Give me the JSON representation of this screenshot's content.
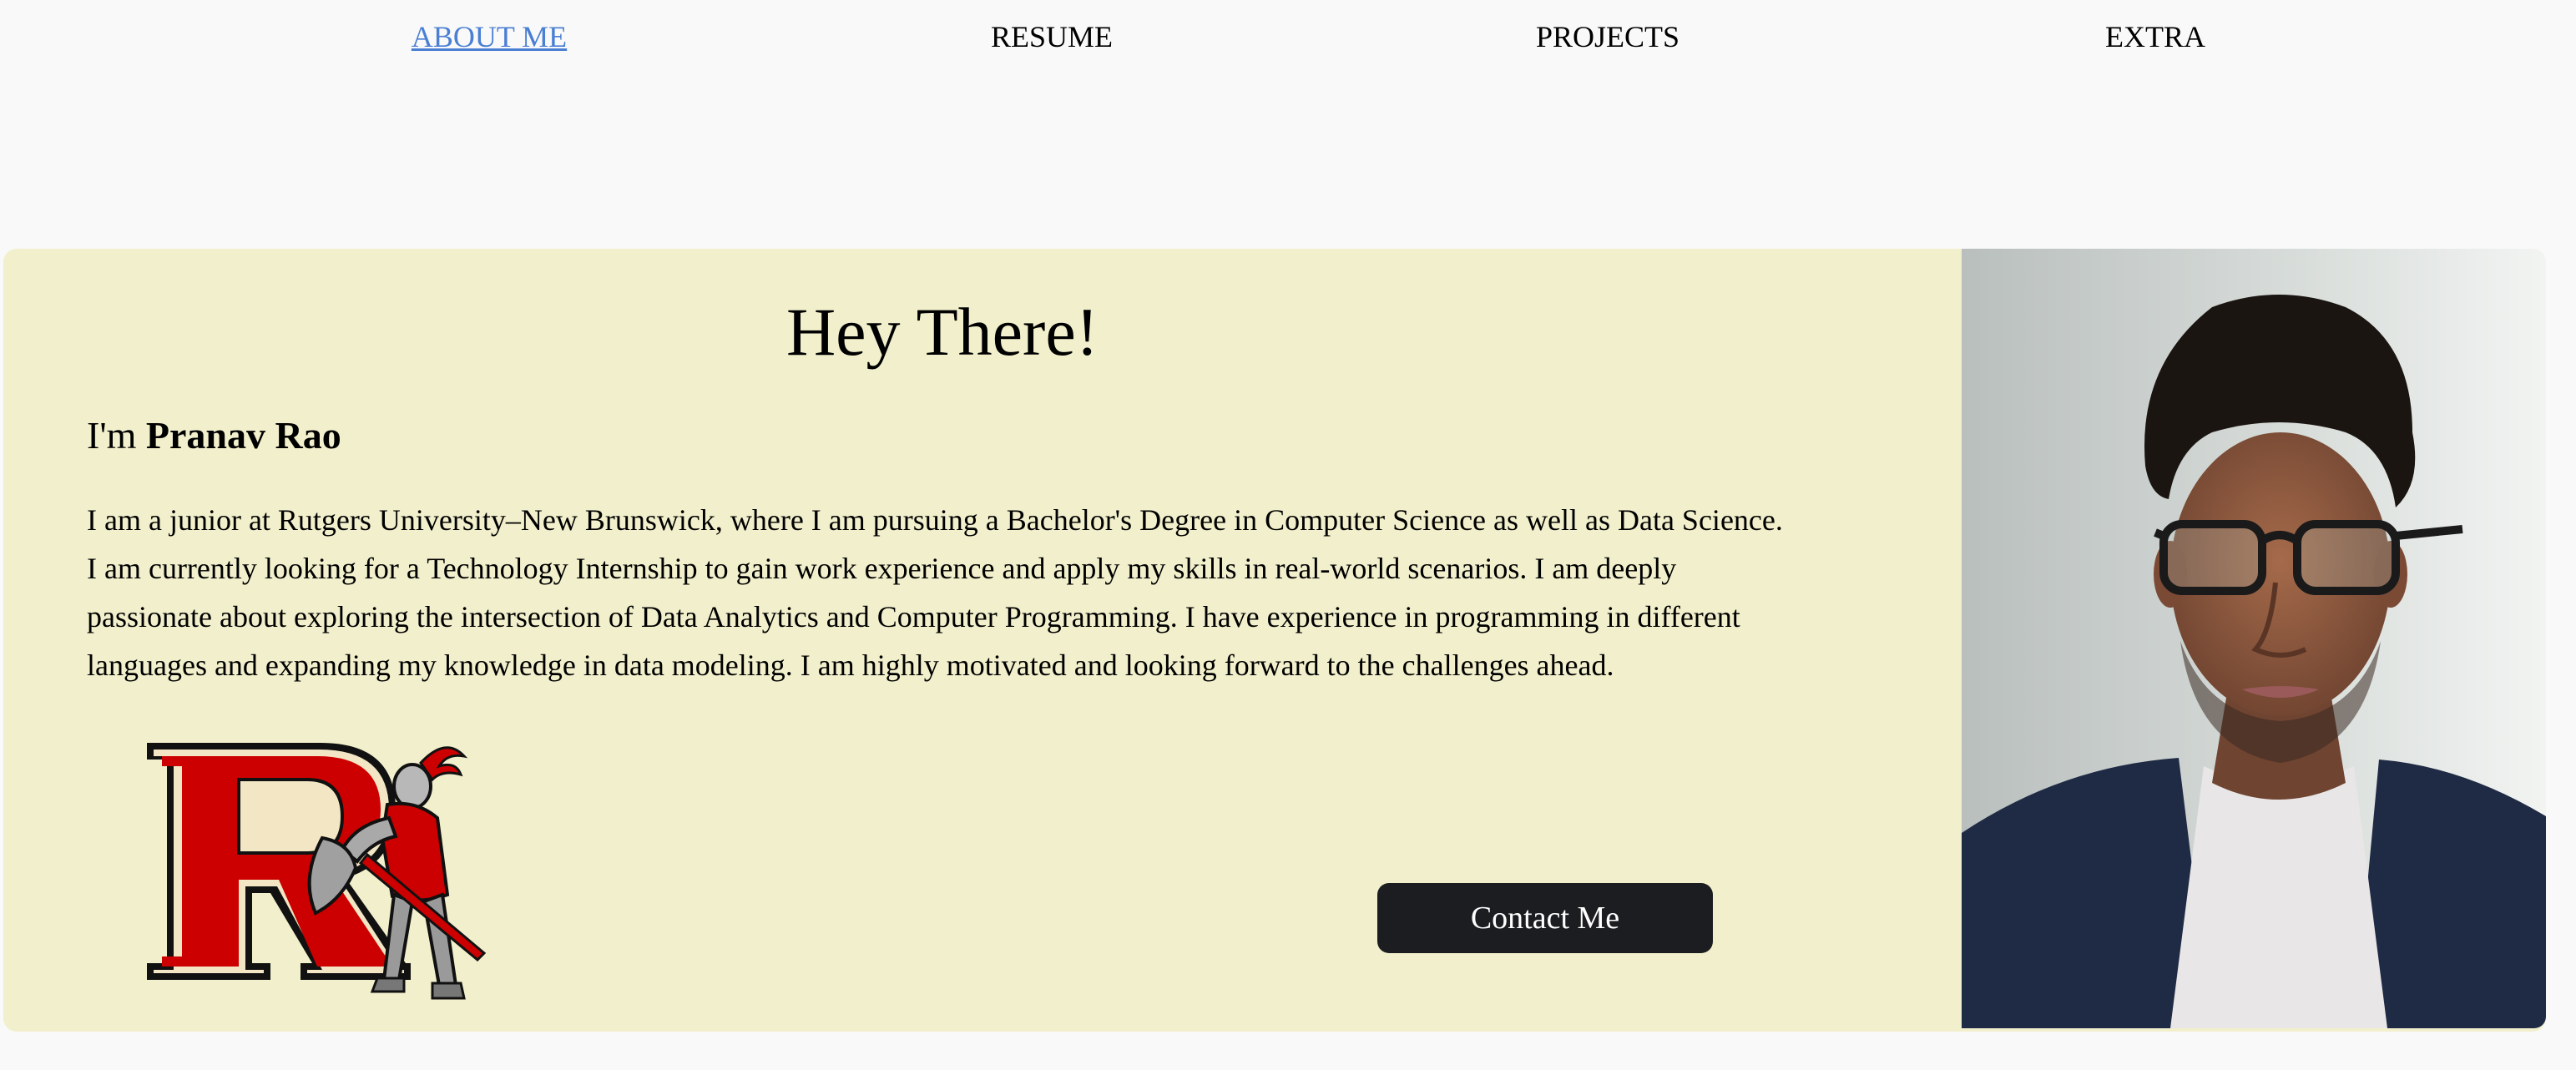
{
  "nav": {
    "items": [
      {
        "label": "ABOUT ME",
        "active": true
      },
      {
        "label": "RESUME",
        "active": false
      },
      {
        "label": "PROJECTS",
        "active": false
      },
      {
        "label": "EXTRA",
        "active": false
      }
    ]
  },
  "hero": {
    "title": "Hey There!",
    "intro_prefix": "I'm",
    "name": "Pranav Rao",
    "bio": "I am a junior at Rutgers University–New Brunswick, where I am pursuing a Bachelor's Degree in Computer Science as well as Data Science. I am currently looking for a Technology Internship to gain work experience and apply my skills in real-world scenarios. I am deeply passionate about exploring the intersection of Data Analytics and Computer Programming. I have experience in programming in different languages and expanding my knowledge in data modeling. I am highly motivated and looking forward to the challenges ahead.",
    "contact_label": "Contact Me"
  },
  "colors": {
    "page_bg": "#f9f9f9",
    "card_bg": "#f2f0cc",
    "active_link": "#4a7fd4",
    "button_bg": "#1b1d20",
    "rutgers_red": "#cc0000"
  },
  "images": {
    "logo": "rutgers-scarlet-knight-logo",
    "photo": "profile-photo"
  }
}
